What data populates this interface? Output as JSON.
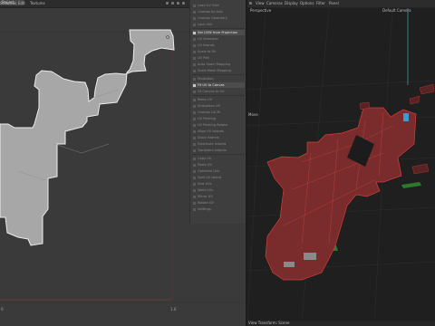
{
  "uv_editor": {
    "header": {
      "menus": [
        "Selection",
        "Edit",
        "Textures"
      ],
      "select_mode": "Project"
    },
    "axis_max_label": "1.0",
    "axis_zero_label": "0"
  },
  "tools_panel": {
    "items": [
      {
        "label": "Load UV Grid",
        "active": false
      },
      {
        "label": "Unwrap by Axis",
        "active": false
      },
      {
        "label": "Unwrap Geometry",
        "active": false
      },
      {
        "label": "Lock UVs",
        "active": false
      },
      {
        "label": "Set UVW from Projection",
        "active": true
      },
      {
        "label": "UV Selection",
        "active": false
      },
      {
        "label": "UV Islands",
        "active": false
      },
      {
        "label": "Scale to Fill",
        "active": false
      },
      {
        "label": "UV Pelt",
        "active": false
      },
      {
        "label": "Auto Seam Mapping",
        "active": false
      },
      {
        "label": "Scale Mesh Mapping",
        "active": false
      },
      {
        "label": "Projection",
        "active": false
      },
      {
        "label": "Fit UV to Canvas",
        "active": true
      },
      {
        "label": "Fit Canvas to UV",
        "active": false
      },
      {
        "label": "Relax UV",
        "active": false
      },
      {
        "label": "Straighten UV",
        "active": false
      },
      {
        "label": "Unwrap LSCM",
        "active": false
      },
      {
        "label": "UV Packing",
        "active": false
      },
      {
        "label": "UV Packing Rotate",
        "active": false
      },
      {
        "label": "Align UV Islands",
        "active": false
      },
      {
        "label": "Stack Islands",
        "active": false
      },
      {
        "label": "Distribute Islands",
        "active": false
      },
      {
        "label": "Transform Islands",
        "active": false
      },
      {
        "label": "Copy UV",
        "active": false
      },
      {
        "label": "Paste UV",
        "active": false
      },
      {
        "label": "Optimize UVs",
        "active": false
      },
      {
        "label": "Split UV Island",
        "active": false
      },
      {
        "label": "Sew UVs",
        "active": false
      },
      {
        "label": "Weld UVs",
        "active": false
      },
      {
        "label": "Mirror UV",
        "active": false
      },
      {
        "label": "Rotate UV",
        "active": false
      },
      {
        "label": "Settings",
        "active": false
      }
    ]
  },
  "viewport": {
    "header": {
      "menus": [
        "View",
        "Cameras",
        "Display",
        "Options",
        "Filter",
        "Panel"
      ]
    },
    "view_name": "Perspective",
    "camera_name": "Default Camera",
    "move_label": "Move",
    "footer_text": "View Transform: Scene"
  },
  "colors": {
    "uv_background": "#3a3a3a",
    "uv_shape_fill": "#a7a7a7",
    "uv_shape_outline": "#ececec",
    "viewport_background": "#1f1f1f",
    "grid": "#2e2e2e",
    "mesh_wire": "#c23a3a",
    "mesh_edge_green": "#3a9b3a",
    "canvas_boundary": "#8a3a3a"
  },
  "icons": {
    "select_mode": "dropdown-chevron-icon",
    "hdr_left": "uv-mode-icon",
    "tools_item": "tool-bullet-icon"
  }
}
